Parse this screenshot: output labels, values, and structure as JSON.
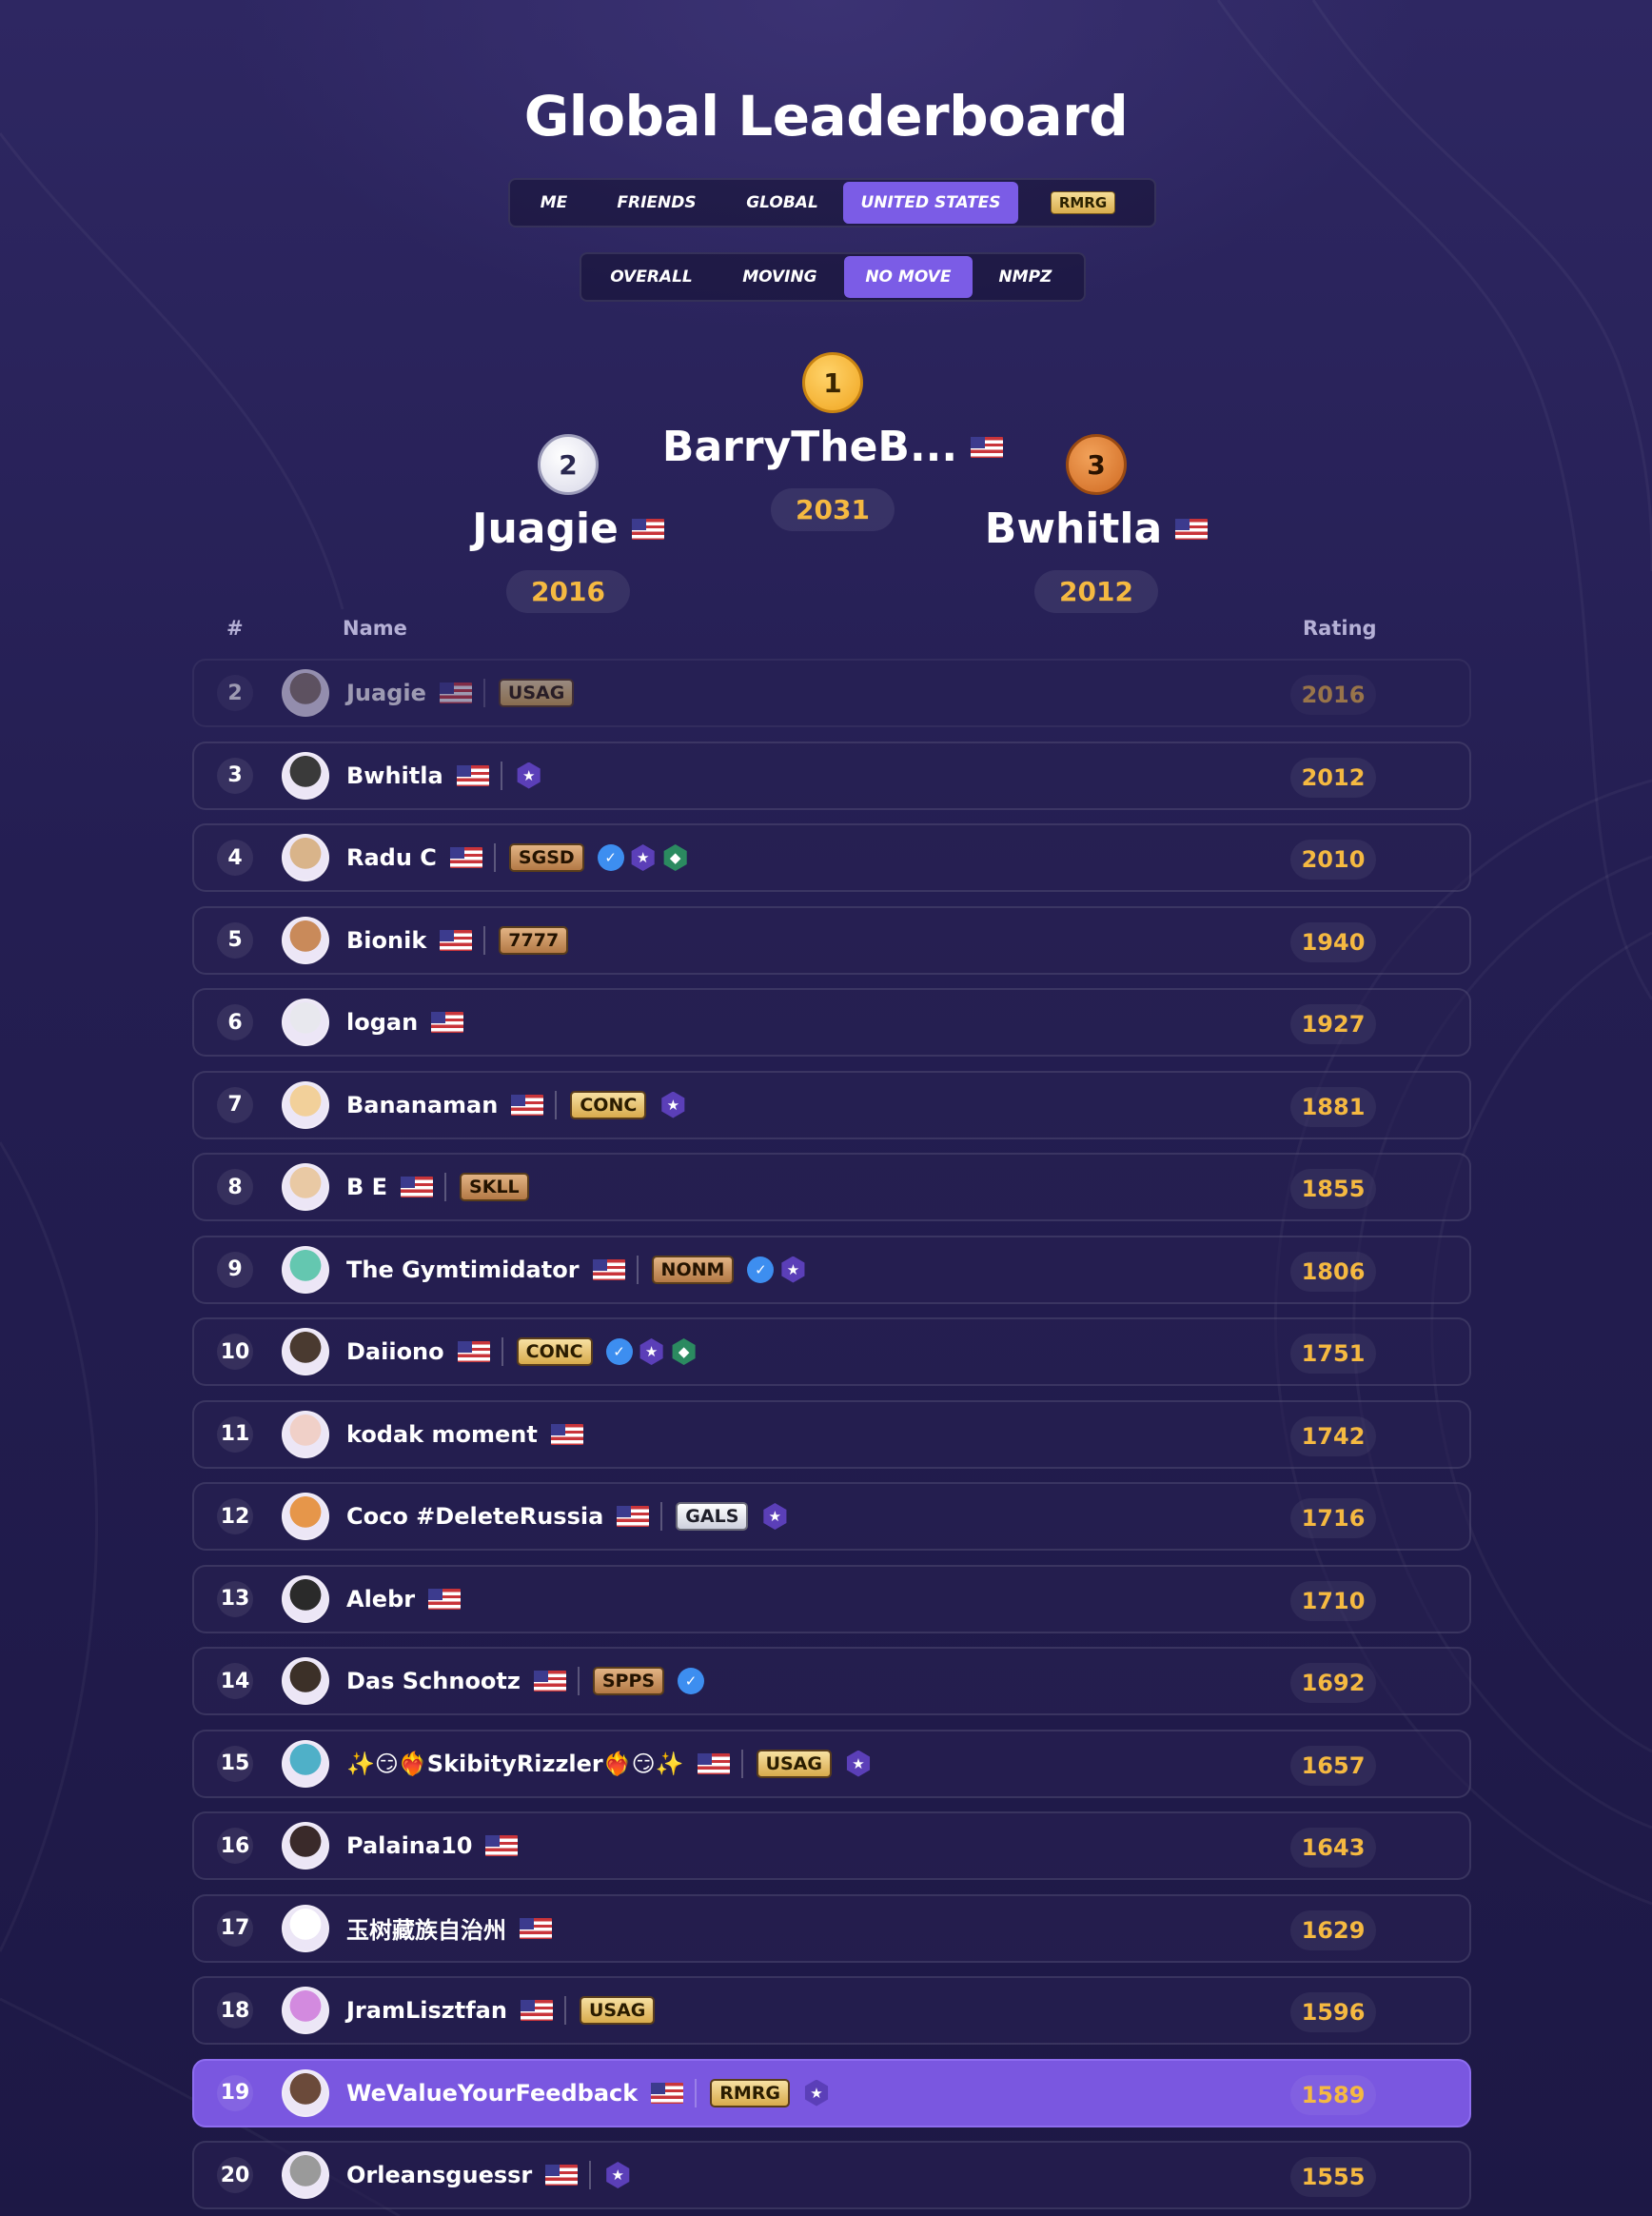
{
  "title": "Global Leaderboard",
  "scope_tabs": [
    {
      "label": "ME",
      "active": false
    },
    {
      "label": "FRIENDS",
      "active": false
    },
    {
      "label": "GLOBAL",
      "active": false
    },
    {
      "label": "UNITED STATES",
      "active": true
    },
    {
      "label": "RMRG",
      "active": false
    }
  ],
  "mode_tabs": [
    {
      "label": "OVERALL",
      "active": false
    },
    {
      "label": "MOVING",
      "active": false
    },
    {
      "label": "NO MOVE",
      "active": true
    },
    {
      "label": "NMPZ",
      "active": false
    }
  ],
  "podium": {
    "first": {
      "rank": "1",
      "name": "BarryTheB...",
      "rating": "2031"
    },
    "second": {
      "rank": "2",
      "name": "Juagie",
      "rating": "2016"
    },
    "third": {
      "rank": "3",
      "name": "Bwhitla",
      "rating": "2012"
    }
  },
  "table": {
    "col_rank": "#",
    "col_name": "Name",
    "col_rating": "Rating"
  },
  "colors": {
    "accent": "#7b5ce6",
    "rating": "#f5b941",
    "gold": "#f0a520",
    "silver": "#e8e8f4",
    "bronze": "#e07b2c"
  },
  "rows": [
    {
      "rank": "2",
      "name": "Juagie",
      "clan": "USAG",
      "clan_style": "gold",
      "icons": [],
      "rating": "2016"
    },
    {
      "rank": "3",
      "name": "Bwhitla",
      "clan": "",
      "icons": [
        "star-badge-icon"
      ],
      "rating": "2012"
    },
    {
      "rank": "4",
      "name": "Radu C",
      "clan": "SGSD",
      "clan_style": "bronze",
      "icons": [
        "verified-icon",
        "star-badge-icon",
        "gem-badge-icon"
      ],
      "rating": "2010"
    },
    {
      "rank": "5",
      "name": "Bionik",
      "clan": "7777",
      "clan_style": "bronze",
      "icons": [],
      "rating": "1940"
    },
    {
      "rank": "6",
      "name": "logan",
      "clan": "",
      "icons": [],
      "rating": "1927"
    },
    {
      "rank": "7",
      "name": "Bananaman",
      "clan": "CONC",
      "clan_style": "gold",
      "icons": [
        "star-badge-icon"
      ],
      "rating": "1881"
    },
    {
      "rank": "8",
      "name": "B E",
      "clan": "SKLL",
      "clan_style": "bronze",
      "icons": [],
      "rating": "1855"
    },
    {
      "rank": "9",
      "name": "The Gymtimidator",
      "clan": "NONM",
      "clan_style": "bronze",
      "icons": [
        "verified-icon",
        "star-badge-icon"
      ],
      "rating": "1806"
    },
    {
      "rank": "10",
      "name": "Daiiono",
      "clan": "CONC",
      "clan_style": "gold",
      "icons": [
        "verified-icon",
        "star-badge-icon",
        "gem-badge-icon"
      ],
      "rating": "1751"
    },
    {
      "rank": "11",
      "name": "kodak moment",
      "clan": "",
      "icons": [],
      "rating": "1742"
    },
    {
      "rank": "12",
      "name": "Coco #DeleteRussia",
      "clan": "GALS",
      "clan_style": "silver",
      "icons": [
        "star-badge-icon"
      ],
      "rating": "1716"
    },
    {
      "rank": "13",
      "name": "Alebr",
      "clan": "",
      "icons": [],
      "rating": "1710"
    },
    {
      "rank": "14",
      "name": "Das Schnootz",
      "clan": "SPPS",
      "clan_style": "bronze",
      "icons": [
        "verified-icon"
      ],
      "rating": "1692"
    },
    {
      "rank": "15",
      "name": "✨😏❤️‍🔥SkibityRizzler❤️‍🔥😏✨",
      "clan": "USAG",
      "clan_style": "gold",
      "icons": [
        "star-badge-icon"
      ],
      "rating": "1657"
    },
    {
      "rank": "16",
      "name": "Palaina10",
      "clan": "",
      "icons": [],
      "rating": "1643"
    },
    {
      "rank": "17",
      "name": "玉树藏族自治州",
      "clan": "",
      "icons": [],
      "rating": "1629"
    },
    {
      "rank": "18",
      "name": "JramLisztfan",
      "clan": "USAG",
      "clan_style": "gold",
      "icons": [],
      "rating": "1596"
    },
    {
      "rank": "19",
      "name": "WeValueYourFeedback",
      "clan": "RMRG",
      "clan_style": "gold",
      "icons": [
        "star-badge-icon"
      ],
      "rating": "1589",
      "current_user": true
    },
    {
      "rank": "20",
      "name": "Orleansguessr",
      "clan": "",
      "icons": [
        "star-badge-icon"
      ],
      "rating": "1555"
    }
  ]
}
